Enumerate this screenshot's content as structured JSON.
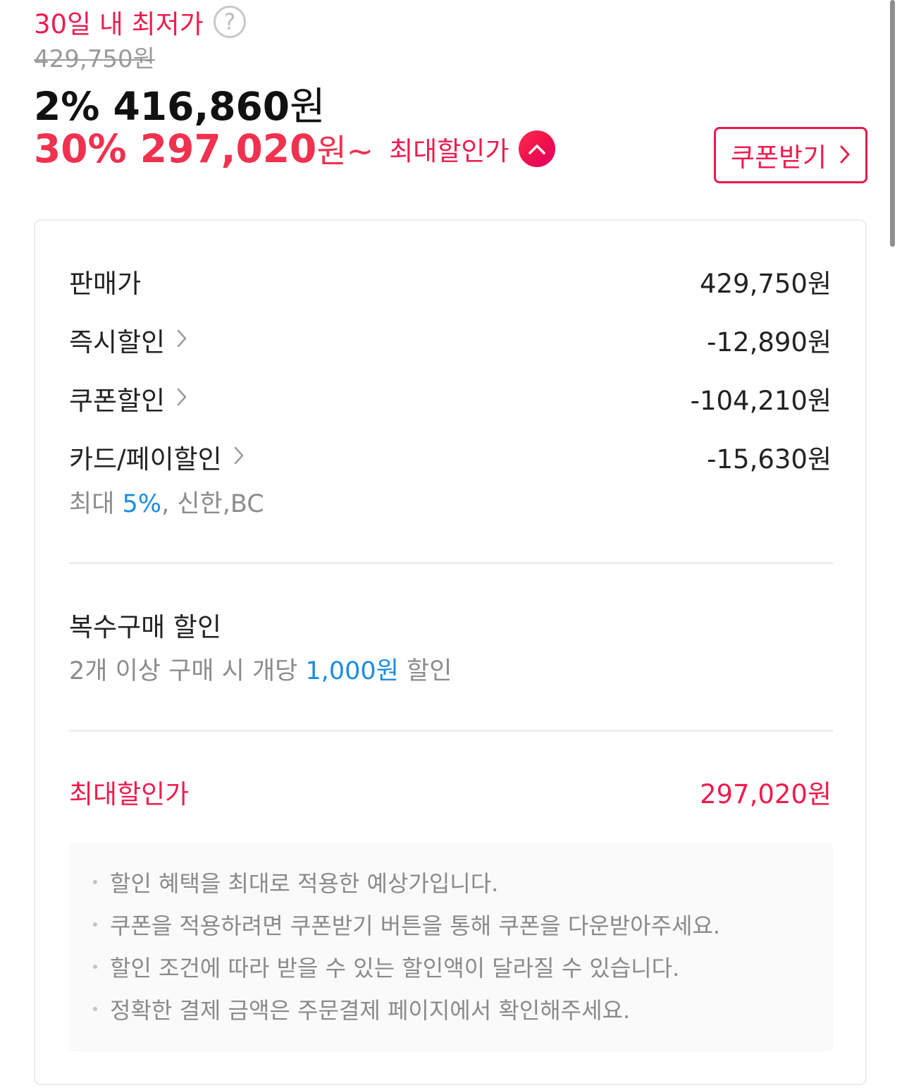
{
  "header": {
    "lowest_label": "30일 내 최저가",
    "help_glyph": "?",
    "original_price": "429,750원",
    "sale_percent_price": "2% 416,860",
    "sale_won": "원",
    "max_percent_price": "30% 297,020",
    "max_won": "원~",
    "max_label": "최대할인가",
    "coupon_button": "쿠폰받기"
  },
  "breakdown": {
    "rows": [
      {
        "label": "판매가",
        "value": "429,750원"
      },
      {
        "label": "즉시할인",
        "value": "-12,890원"
      },
      {
        "label": "쿠폰할인",
        "value": "-104,210원"
      },
      {
        "label": "카드/페이할인",
        "value": "-15,630원"
      }
    ],
    "card_note": {
      "prefix": "최대 ",
      "highlight": "5%",
      "suffix": ", 신한,BC"
    }
  },
  "multi_buy": {
    "title": "복수구매 할인",
    "desc_prefix": "2개 이상 구매 시 개당 ",
    "desc_highlight": "1,000원",
    "desc_suffix": " 할인"
  },
  "max_discount": {
    "label": "최대할인가",
    "value": "297,020원"
  },
  "notes": [
    "할인 혜택을 최대로 적용한 예상가입니다.",
    "쿠폰을 적용하려면 쿠폰받기 버튼을 통해 쿠폰을 다운받아주세요.",
    "할인 조건에 따라 받을 수 있는 할인액이 달라질 수 있습니다.",
    "정확한 결제 금액은 주문결제 페이지에서 확인해주세요."
  ],
  "icons": {
    "help": "question-circle-icon",
    "collapse": "chevron-up-icon",
    "coupon_arrow": "chevron-right-icon",
    "row_arrow": "chevron-right-icon"
  },
  "colors": {
    "accent": "#ee1c4e",
    "link_blue": "#1b8ce3",
    "muted": "#8c8c8c"
  }
}
